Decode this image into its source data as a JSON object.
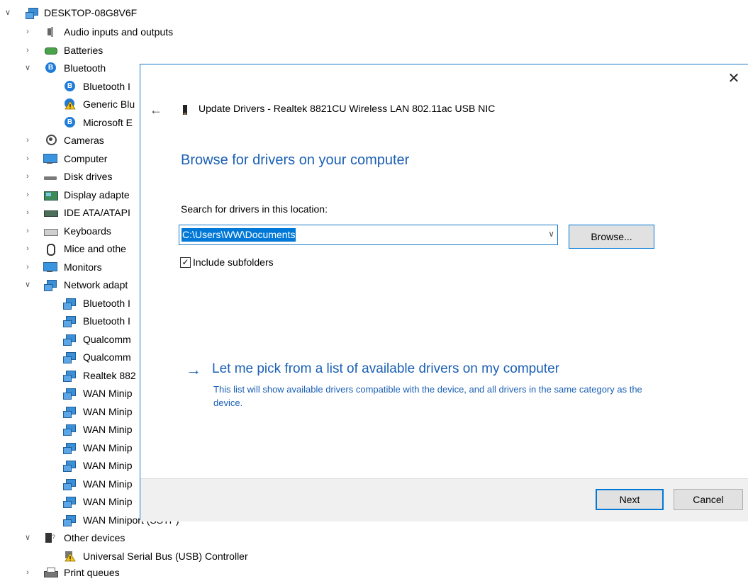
{
  "tree": {
    "root": "DESKTOP-08G8V6F",
    "items": [
      "Audio inputs and outputs",
      "Batteries",
      "Bluetooth",
      "Bluetooth I",
      "Generic Blu",
      "Microsoft E",
      "Cameras",
      "Computer",
      "Disk drives",
      "Display adapte",
      "IDE ATA/ATAPI",
      "Keyboards",
      "Mice and othe",
      "Monitors",
      "Network adapt",
      "Bluetooth I",
      "Bluetooth I",
      "Qualcomm",
      "Qualcomm",
      "Realtek 882",
      "WAN Minip",
      "WAN Minip",
      "WAN Minip",
      "WAN Minip",
      "WAN Minip",
      "WAN Minip",
      "WAN Minip",
      "WAN Miniport (SSTP)",
      "Other devices",
      "Universal Serial Bus (USB) Controller",
      "Print queues"
    ]
  },
  "dialog": {
    "title": "Update Drivers - Realtek 8821CU Wireless LAN 802.11ac USB NIC",
    "heading": "Browse for drivers on your computer",
    "location_label": "Search for drivers in this location:",
    "location_value": "C:\\Users\\WW\\Documents",
    "browse_label": "Browse...",
    "subfolders_label": "Include subfolders",
    "subfolders_checked": true,
    "pick_link": "Let me pick from a list of available drivers on my computer",
    "pick_description": "This list will show available drivers compatible with the device, and all drivers in the same category as the device.",
    "next_label": "Next",
    "cancel_label": "Cancel",
    "close_glyph": "✕",
    "back_glyph": "←",
    "arrow_glyph": "→",
    "check_glyph": "✓"
  },
  "colors": {
    "accent": "#0078d7",
    "link": "#1a5fb4",
    "footer_bg": "#f0f0f0"
  }
}
